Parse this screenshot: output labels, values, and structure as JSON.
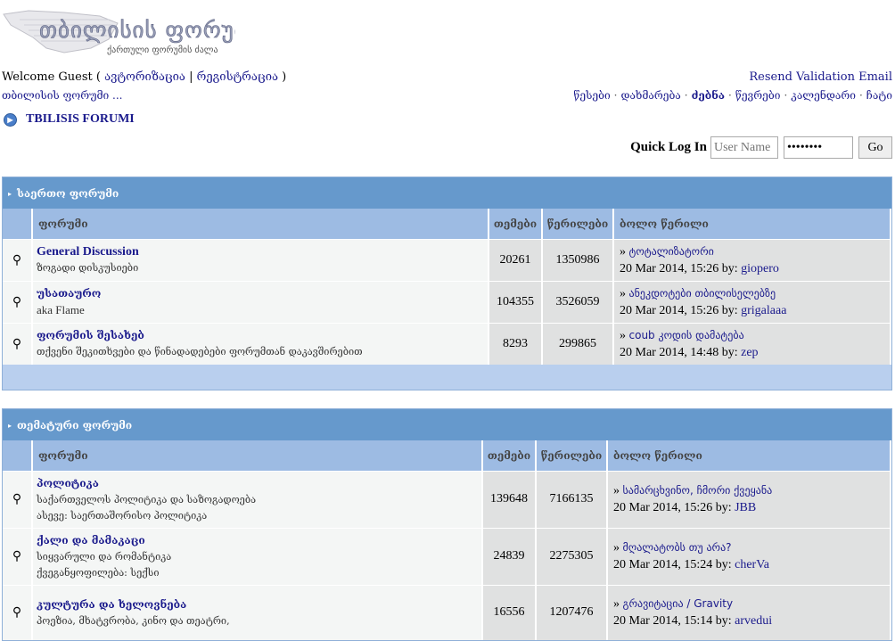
{
  "logo": {
    "title": "თბილისის ფორუმი",
    "subtitle": "ქართული ფორუმის ძალა"
  },
  "welcome": {
    "prefix": "Welcome Guest ( ",
    "login": "ავტორიზაცია",
    "sep": " | ",
    "register": "რეგისტრაცია",
    "suffix": " )"
  },
  "breadcrumb": "თბილისის ფორუმი ...",
  "resend": "Resend Validation Email",
  "nav": [
    "წესები",
    "დახმარება",
    "ძებნა",
    "წევრები",
    "კალენდარი",
    "ჩატი"
  ],
  "forum_title": "TBILISIS FORUMI",
  "quick_login": {
    "label": "Quick Log In",
    "username_placeholder": "User Name",
    "password": "password",
    "go": "Go"
  },
  "columns": {
    "forum": "ფორუმი",
    "topics": "თემები",
    "posts": "წერილები",
    "last": "ბოლო წერილი"
  },
  "last_prefix": "»",
  "by": "by:",
  "sections": [
    {
      "title": "საერთო ფორუმი",
      "forums": [
        {
          "name": "General Discussion",
          "desc": [
            "ზოგადი დისკუსიები"
          ],
          "topics": "20261",
          "posts": "1350986",
          "last_title": "ტოტალიზატორი",
          "last_date": "20 Mar 2014, 15:26",
          "last_user": "giopero"
        },
        {
          "name": "უსათაურო",
          "desc": [
            "aka Flame"
          ],
          "topics": "104355",
          "posts": "3526059",
          "last_title": "ანეკდოტები თბილისელებზე",
          "last_date": "20 Mar 2014, 15:26",
          "last_user": "grigalaaa"
        },
        {
          "name": "ფორუმის შესახებ",
          "desc": [
            "თქვენი შეკითხვები და წინადადებები ფორუმთან დაკავშირებით"
          ],
          "topics": "8293",
          "posts": "299865",
          "last_title": "coub კოდის დამატება",
          "last_date": "20 Mar 2014, 14:48",
          "last_user": "zep"
        }
      ]
    },
    {
      "title": "თემატური ფორუმი",
      "forums": [
        {
          "name": "პოლიტიკა",
          "desc": [
            "საქართველოს პოლიტიკა და საზოგადოება",
            "ასევე: საერთაშორისო პოლიტიკა"
          ],
          "topics": "139648",
          "posts": "7166135",
          "last_title": "სამარცხვინო, ჩმორი ქვეყანა",
          "last_date": "20 Mar 2014, 15:26",
          "last_user": "JBB"
        },
        {
          "name": "ქალი და მამაკაცი",
          "desc": [
            "სიყვარული და რომანტიკა",
            "ქვეგანყოფილება: სექსი"
          ],
          "topics": "24839",
          "posts": "2275305",
          "last_title": "მღალატობს თუ არა?",
          "last_date": "20 Mar 2014, 15:24",
          "last_user": "cherVa"
        },
        {
          "name": "კულტურა და ხელოვნება",
          "desc": [
            "პოეზია, მხატვრობა, კინო და თეატრი,"
          ],
          "topics": "16556",
          "posts": "1207476",
          "last_title": "გრავიტაცია / Gravity",
          "last_date": "20 Mar 2014, 15:14",
          "last_user": "arvedui"
        }
      ]
    }
  ]
}
